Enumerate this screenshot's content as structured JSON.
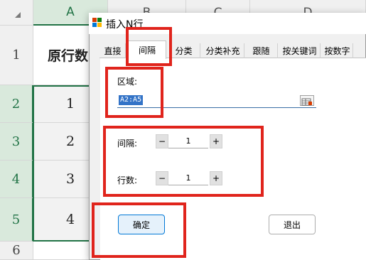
{
  "sheet": {
    "columns": [
      "A",
      "B",
      "C",
      "D"
    ],
    "rows": [
      {
        "num": "1",
        "value": "原行数"
      },
      {
        "num": "2",
        "value": "1"
      },
      {
        "num": "3",
        "value": "2"
      },
      {
        "num": "4",
        "value": "3"
      },
      {
        "num": "5",
        "value": "4"
      },
      {
        "num": "6",
        "value": ""
      }
    ]
  },
  "dialog": {
    "title": "插入N行",
    "tabs": [
      "直接",
      "间隔",
      "分类",
      "分类补充",
      "跟随",
      "按关键词",
      "按数字"
    ],
    "active_tab": "间隔",
    "region": {
      "label": "区域:",
      "value": "A2:A5"
    },
    "interval": {
      "label": "间隔:",
      "minus": "−",
      "value": "1",
      "plus": "+"
    },
    "rows": {
      "label": "行数:",
      "minus": "−",
      "value": "1",
      "plus": "+"
    },
    "ok_label": "确定",
    "exit_label": "退出"
  },
  "colors": {
    "accent": "#217346",
    "highlight": "#e0241c",
    "selection": "#3373c7"
  }
}
